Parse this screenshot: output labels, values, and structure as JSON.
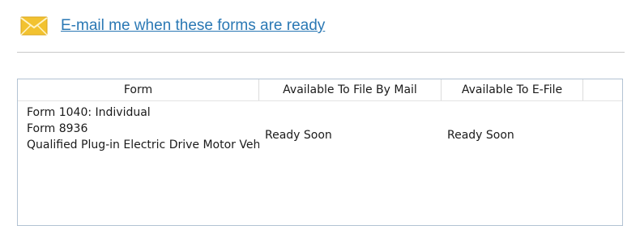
{
  "notify": {
    "link_text": "E-mail me when these forms are ready",
    "icon": "envelope-icon"
  },
  "colors": {
    "link": "#2a78b4",
    "envelope": "#f2c230",
    "grid_border": "#b3c3d3"
  },
  "table": {
    "columns": [
      "Form",
      "Available To File By Mail",
      "Available To E-File"
    ],
    "rows": [
      {
        "form_line1": "Form 1040:  Individual",
        "form_line2": "Form 8936",
        "form_line3": "Qualified Plug-in Electric Drive Motor Vehi",
        "mail_status": "Ready Soon",
        "efile_status": "Ready Soon"
      }
    ]
  }
}
